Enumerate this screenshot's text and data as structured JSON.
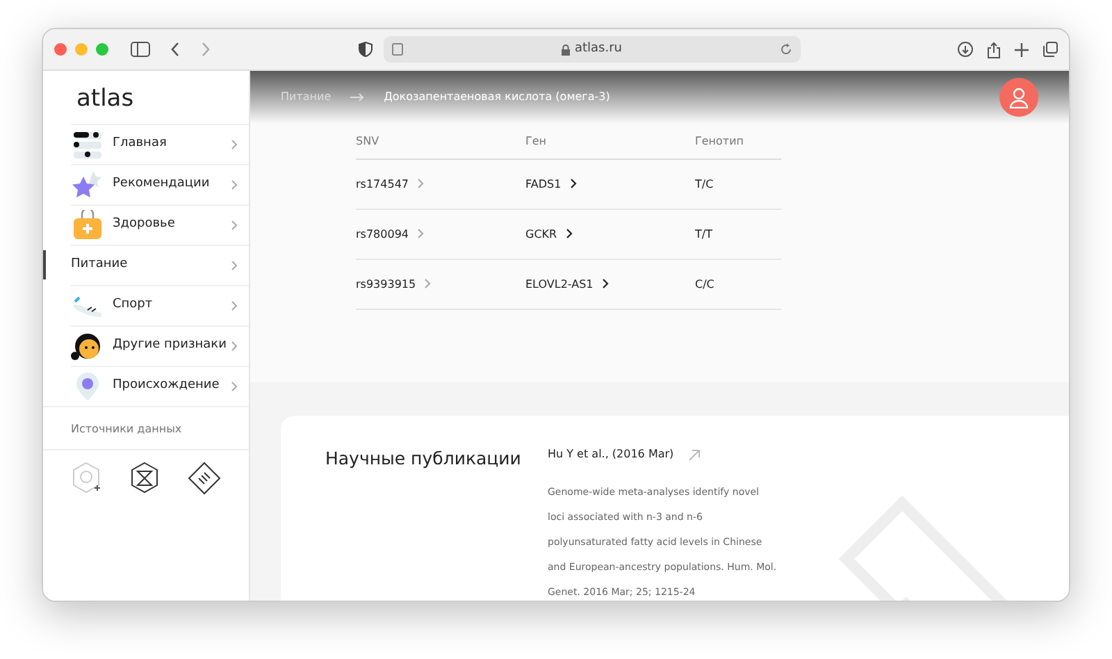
{
  "browser": {
    "address": "atlas.ru"
  },
  "sidebar": {
    "logo": "atlas",
    "items": [
      {
        "label": "Главная",
        "selected": false
      },
      {
        "label": "Рекомендации",
        "selected": false
      },
      {
        "label": "Здоровье",
        "selected": false
      },
      {
        "label": "Питание",
        "selected": true
      },
      {
        "label": "Спорт",
        "selected": false
      },
      {
        "label": "Другие признаки",
        "selected": false
      },
      {
        "label": "Происхождение",
        "selected": false
      }
    ],
    "sources_title": "Источники данных"
  },
  "breadcrumb": [
    "Питание",
    "Докозапентаеновая кислота (омега-3)"
  ],
  "table": {
    "columns": [
      "SNV",
      "Ген",
      "Генотип"
    ],
    "rows": [
      {
        "snv": "rs174547",
        "gene": "FADS1",
        "genotype": "T/C"
      },
      {
        "snv": "rs780094",
        "gene": "GCKR",
        "genotype": "T/T"
      },
      {
        "snv": "rs9393915",
        "gene": "ELOVL2-AS1",
        "genotype": "C/C"
      }
    ]
  },
  "publications": {
    "title": "Научные публикации",
    "items": [
      {
        "citation": "Hu Y et al., (2016 Mar)",
        "abstract": "Genome-wide meta-analyses identify novel loci associated with n-3 and n-6 polyunsaturated fatty acid levels in Chinese and European-ancestry populations. Hum. Mol. Genet. 2016 Mar; 25; 1215-24"
      }
    ]
  }
}
